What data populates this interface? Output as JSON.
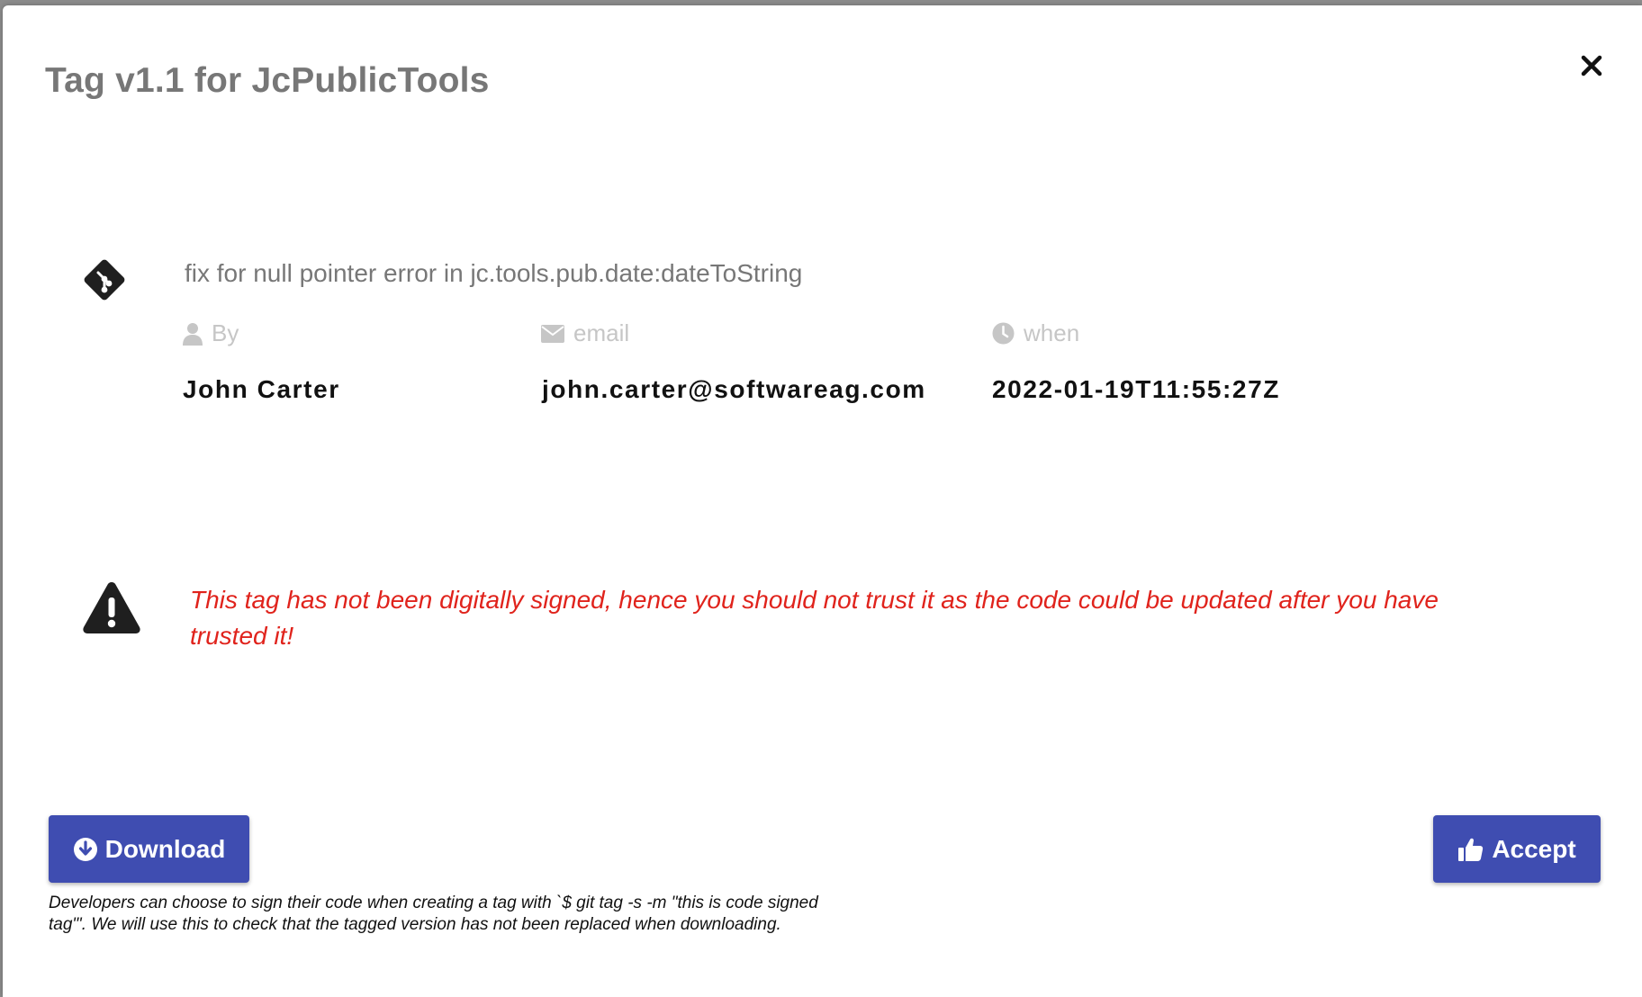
{
  "dialog": {
    "title": "Tag v1.1 for JcPublicTools",
    "close_icon": "close-icon"
  },
  "commit": {
    "message": "fix for null pointer error in jc.tools.pub.date:dateToString",
    "labels": {
      "by": "By",
      "email": "email",
      "when": "when"
    },
    "values": {
      "author": "John Carter",
      "email": "john.carter@softwareag.com",
      "when": "2022-01-19T11:55:27Z"
    }
  },
  "warning": {
    "text": "This tag has not been digitally signed, hence you should not trust it as the code could be updated after you have trusted it!",
    "color": "#e0231c"
  },
  "actions": {
    "download_label": "Download",
    "accept_label": "Accept",
    "button_color": "#3f4db1"
  },
  "footnote": "Developers can choose to sign their code when creating a tag with `$ git tag -s -m \"this is code signed tag\"'. We will use this to check that the tagged version has not been replaced when downloading."
}
